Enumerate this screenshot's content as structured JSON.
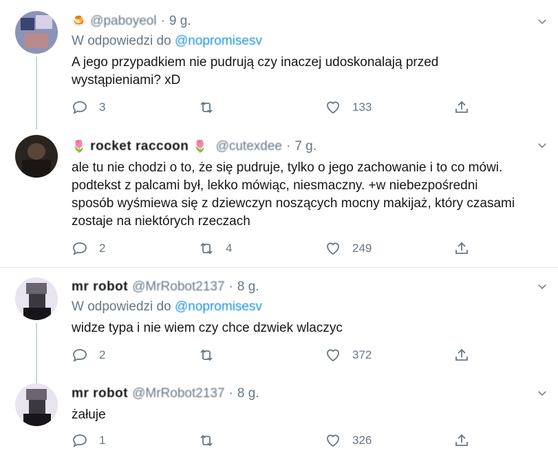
{
  "tweets": [
    {
      "emoji": "🍮",
      "name": "@paboyeol",
      "handle": "",
      "time": "9 g.",
      "reply_prefix": "W odpowiedzi do",
      "reply_mention": "@nopromisesv",
      "text_lines": [
        "A jego przypadkiem nie pudrują czy inaczej udoskonalają przed",
        "wystąpieniami? xD"
      ],
      "replies": "3",
      "retweets": "",
      "likes": "133"
    },
    {
      "emoji": "🌷",
      "name": "rocket raccoon",
      "emoji_after": "🌷",
      "handle": "@cutexdee",
      "time": "7 g.",
      "text_lines": [
        "ale tu nie chodzi o to, że się pudruje, tylko o jego zachowanie i to co mówi.",
        "podtekst z palcami był, lekko mówiąc, niesmaczny. +w niebezpośredni",
        "sposób wyśmiewa się z dziewczyn noszących mocny makijaż, który czasami",
        "zostaje na niektórych rzeczach"
      ],
      "replies": "2",
      "retweets": "4",
      "likes": "249"
    },
    {
      "name": "mr robot",
      "handle": "@MrRobot2137",
      "time": "8 g.",
      "reply_prefix": "W odpowiedzi do",
      "reply_mention": "@nopromisesv",
      "text_lines": [
        "widze typa i nie wiem czy chce dzwiek wlaczyc"
      ],
      "replies": "2",
      "retweets": "",
      "likes": "372"
    },
    {
      "name": "mr robot",
      "handle": "@MrRobot2137",
      "time": "8 g.",
      "text_lines": [
        "żałuje"
      ],
      "replies": "1",
      "retweets": "",
      "likes": "326"
    }
  ],
  "icons": {
    "reply": "reply-icon",
    "retweet": "retweet-icon",
    "like": "heart-icon",
    "share": "share-icon",
    "more": "chevron-down-icon"
  },
  "colors": {
    "text": "#14171a",
    "secondary": "#657786",
    "link": "#1b95e0",
    "divider": "#e6ecf0"
  }
}
